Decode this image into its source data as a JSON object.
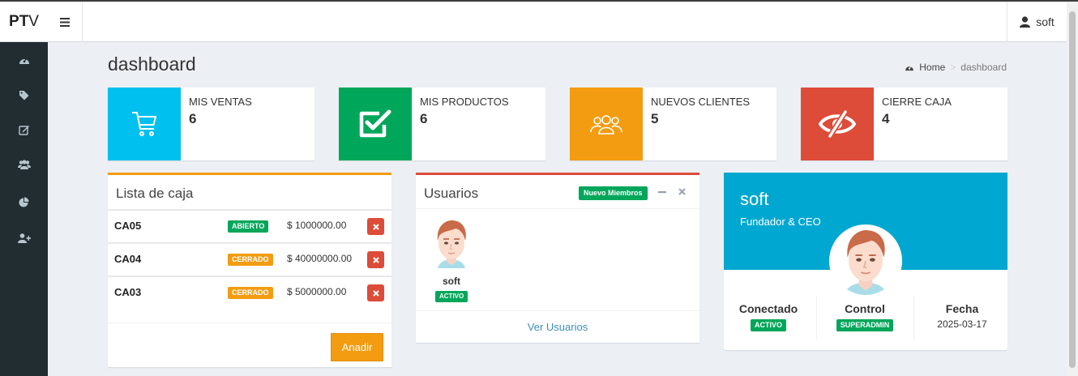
{
  "app": {
    "logo_bold": "PT",
    "logo_rest": "V"
  },
  "navbar": {
    "toggle_icon": "hamburger-icon",
    "user_name": "soft"
  },
  "sidebar": {
    "icons": [
      "dashboard-icon",
      "tag-icon",
      "edit-icon",
      "users-icon",
      "pie-chart-icon",
      "user-plus-icon"
    ]
  },
  "header": {
    "title": "dashboard",
    "breadcrumb_home": "Home",
    "breadcrumb_current": "dashboard"
  },
  "info_boxes": [
    {
      "label": "MIS VENTAS",
      "value": "6",
      "color": "#00c0ef",
      "icon": "cart-icon"
    },
    {
      "label": "MIS PRODUCTOS",
      "value": "6",
      "color": "#00a65a",
      "icon": "check-square-icon"
    },
    {
      "label": "NUEVOS CLIENTES",
      "value": "5",
      "color": "#f39c12",
      "icon": "group-icon"
    },
    {
      "label": "CIERRE CAJA",
      "value": "4",
      "color": "#dd4b39",
      "icon": "eye-slash-icon"
    }
  ],
  "cajas": {
    "title": "Lista de caja",
    "border_color": "#f39c12",
    "rows": [
      {
        "code": "CA05",
        "status": "ABIERTO",
        "amount": "$ 1000000.00"
      },
      {
        "code": "CA04",
        "status": "CERRADO",
        "amount": "$ 40000000.00"
      },
      {
        "code": "CA03",
        "status": "CERRADO",
        "amount": "$ 5000000.00"
      }
    ],
    "add_button": "Anadir"
  },
  "usuarios": {
    "title": "Usuarios",
    "border_color": "#dd4b39",
    "badge": "Nuevo Miembros",
    "user_name": "soft",
    "user_status": "ACTIVO",
    "footer_link": "Ver Usuarios"
  },
  "profile": {
    "name": "soft",
    "role": "Fundador & CEO",
    "stats": [
      {
        "title": "Conectado",
        "value": "ACTIVO"
      },
      {
        "title": "Control",
        "value": "SUPERADMIN"
      },
      {
        "title": "Fecha",
        "value": "2025-03-17"
      }
    ]
  }
}
